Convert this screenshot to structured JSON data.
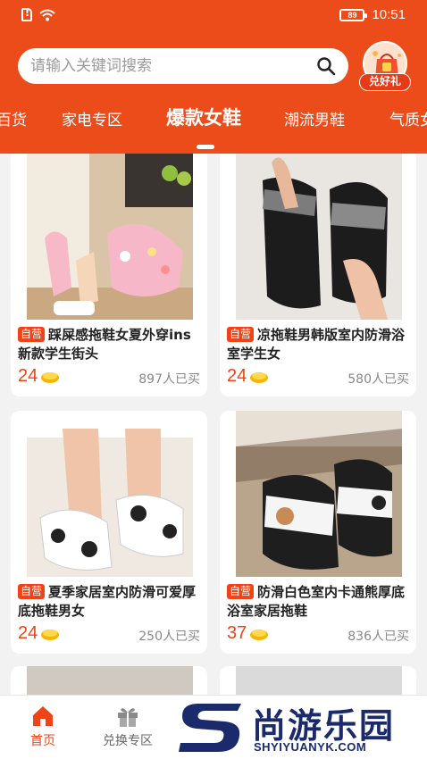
{
  "status_bar": {
    "battery": "89",
    "time": "10:51"
  },
  "search": {
    "placeholder": "请输入关键词搜索"
  },
  "gift_button": {
    "label": "兑好礼"
  },
  "tabs": [
    {
      "label": "百货"
    },
    {
      "label": "家电专区"
    },
    {
      "label": "爆款女鞋",
      "active": true
    },
    {
      "label": "潮流男鞋"
    },
    {
      "label": "气质女"
    }
  ],
  "products": [
    {
      "badge": "自营",
      "title": "踩屎感拖鞋女夏外穿ins新款学生街头",
      "price": "24",
      "sold": "897人已买"
    },
    {
      "badge": "自营",
      "title": "凉拖鞋男韩版室内防滑浴室学生女",
      "price": "24",
      "sold": "580人已买"
    },
    {
      "badge": "自营",
      "title": "夏季家居室内防滑可爱厚底拖鞋男女",
      "price": "24",
      "sold": "250人已买"
    },
    {
      "badge": "自营",
      "title": "防滑白色室内卡通熊厚底浴室家居拖鞋",
      "price": "37",
      "sold": "836人已买"
    }
  ],
  "bottom_nav": [
    {
      "label": "首页",
      "active": true
    },
    {
      "label": "兑换专区"
    }
  ],
  "watermark": {
    "cn": "尚游乐园",
    "en": "SHYIYUANYK.COM"
  },
  "colors": {
    "brand": "#ec4c19",
    "price": "#ee4416",
    "badge": "#ee4416",
    "coin": "#f6b500"
  }
}
